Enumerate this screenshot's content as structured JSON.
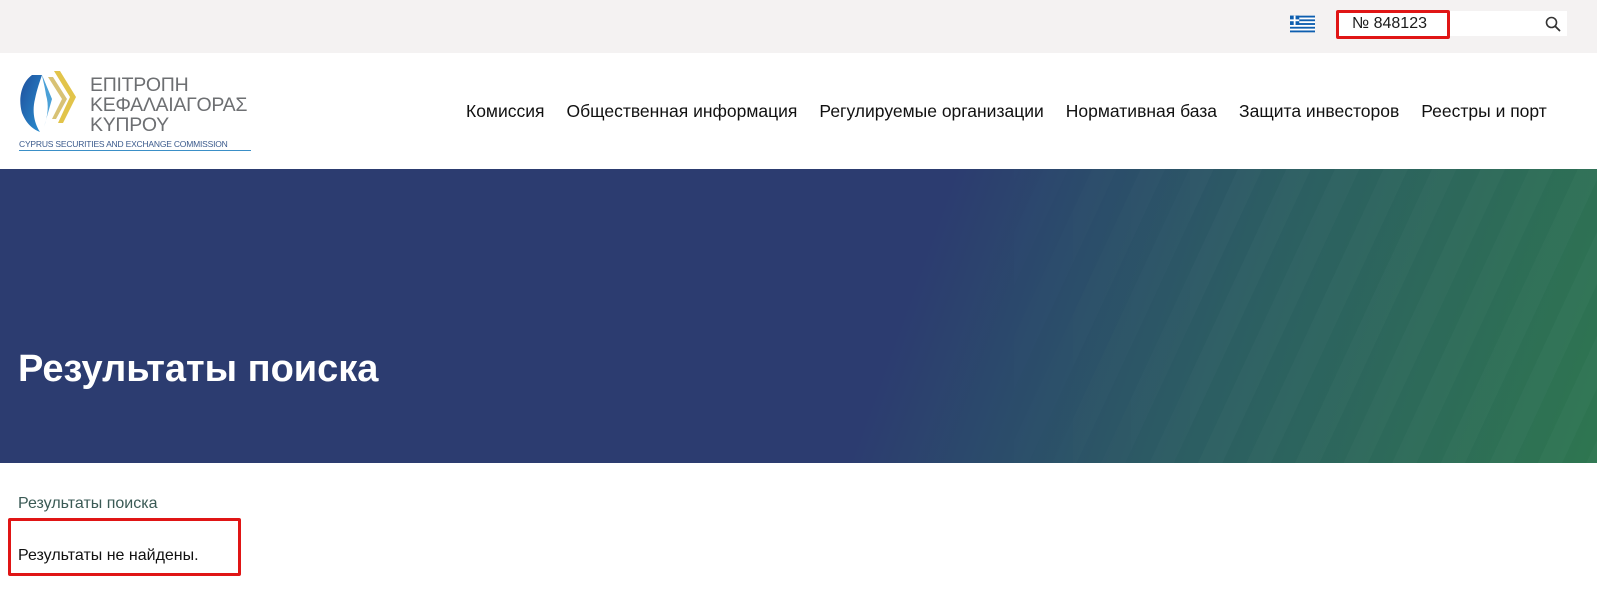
{
  "topbar": {
    "language_flag": "greek-flag-icon",
    "search": {
      "value": "№ 848123",
      "placeholder": ""
    },
    "search_icon": "magnifier-icon"
  },
  "header": {
    "logo": {
      "line1": "ΕΠΙΤΡΟΠΗ",
      "line2": "ΚΕΦΑΛΑΙΑΓΟΡΑΣ",
      "line3": "ΚΥΠΡΟΥ",
      "subtitle": "CYPRUS SECURITIES AND EXCHANGE COMMISSION"
    },
    "nav": [
      {
        "label": "Комиссия"
      },
      {
        "label": "Общественная информация"
      },
      {
        "label": "Регулируемые организации"
      },
      {
        "label": "Нормативная база"
      },
      {
        "label": "Защита инвесторов"
      },
      {
        "label": "Реестры и порт"
      }
    ]
  },
  "hero": {
    "title": "Результаты поиска"
  },
  "content": {
    "breadcrumb": "Результаты поиска",
    "message": "Результаты не найдены."
  },
  "colors": {
    "hero_blue": "#2c3c70",
    "hero_green": "#2e7650",
    "highlight_red": "#e01515",
    "topbar_bg": "#f4f2f2"
  }
}
